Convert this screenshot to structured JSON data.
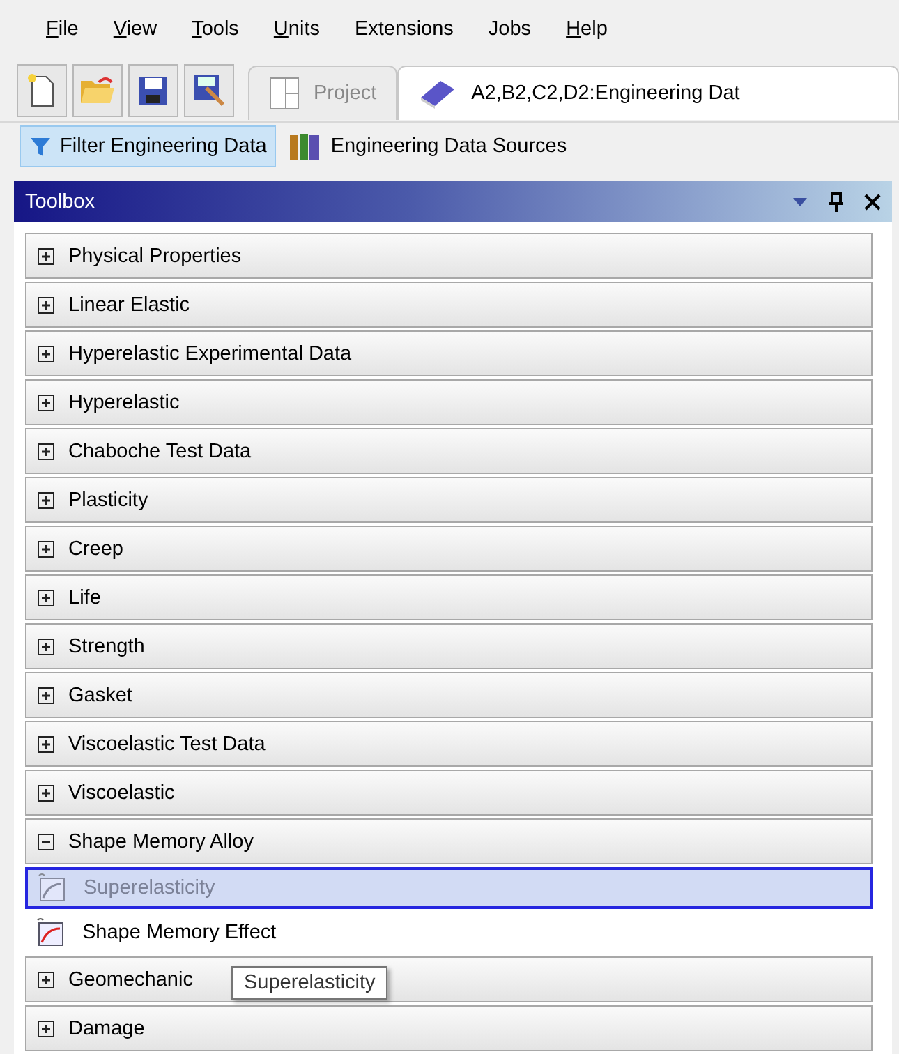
{
  "menu": [
    {
      "label": "File",
      "accelerator": true
    },
    {
      "label": "View",
      "accelerator": true
    },
    {
      "label": "Tools",
      "accelerator": true
    },
    {
      "label": "Units",
      "accelerator": true
    },
    {
      "label": "Extensions",
      "accelerator": false
    },
    {
      "label": "Jobs",
      "accelerator": false
    },
    {
      "label": "Help",
      "accelerator": true
    }
  ],
  "document_tabs": [
    {
      "label": "Project",
      "kind": "project",
      "selected": false
    },
    {
      "label": "A2,B2,C2,D2:Engineering Dat",
      "kind": "book",
      "selected": true
    }
  ],
  "toolbar": [
    {
      "label": "Filter Engineering Data",
      "kind": "filter",
      "selected": true
    },
    {
      "label": "Engineering Data Sources",
      "kind": "books",
      "selected": false
    }
  ],
  "toolbox": {
    "title": "Toolbox",
    "groups": [
      {
        "label": "Physical Properties",
        "expanded": false
      },
      {
        "label": "Linear Elastic",
        "expanded": false
      },
      {
        "label": "Hyperelastic Experimental Data",
        "expanded": false
      },
      {
        "label": "Hyperelastic",
        "expanded": false
      },
      {
        "label": "Chaboche Test Data",
        "expanded": false
      },
      {
        "label": "Plasticity",
        "expanded": false
      },
      {
        "label": "Creep",
        "expanded": false
      },
      {
        "label": "Life",
        "expanded": false
      },
      {
        "label": "Strength",
        "expanded": false
      },
      {
        "label": "Gasket",
        "expanded": false
      },
      {
        "label": "Viscoelastic Test Data",
        "expanded": false
      },
      {
        "label": "Viscoelastic",
        "expanded": false
      },
      {
        "label": "Shape Memory Alloy",
        "expanded": true,
        "children": [
          {
            "label": "Superelasticity",
            "selected": true,
            "disabled": true
          },
          {
            "label": "Shape Memory Effect",
            "selected": false,
            "disabled": false
          }
        ]
      },
      {
        "label": "Geomechanic",
        "expanded": false
      },
      {
        "label": "Damage",
        "expanded": false
      }
    ]
  },
  "tooltip": {
    "text": "Superelasticity"
  }
}
